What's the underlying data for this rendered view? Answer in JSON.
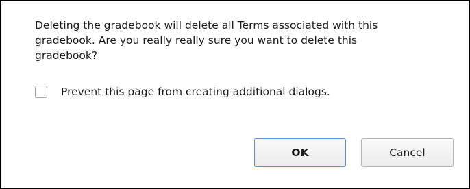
{
  "dialog": {
    "message_line1": "Deleting the gradebook will delete all Terms associated with this",
    "message_line2": "gradebook.  Are you really really sure you want to delete this",
    "message_line3": "gradebook?",
    "prevent_label": "Prevent this page from creating additional dialogs.",
    "prevent_checked": false,
    "ok_label": "OK",
    "cancel_label": "Cancel"
  },
  "colors": {
    "ok_border": "#5a8fd6",
    "button_border": "#b5b5b5",
    "dialog_border": "#000000"
  }
}
